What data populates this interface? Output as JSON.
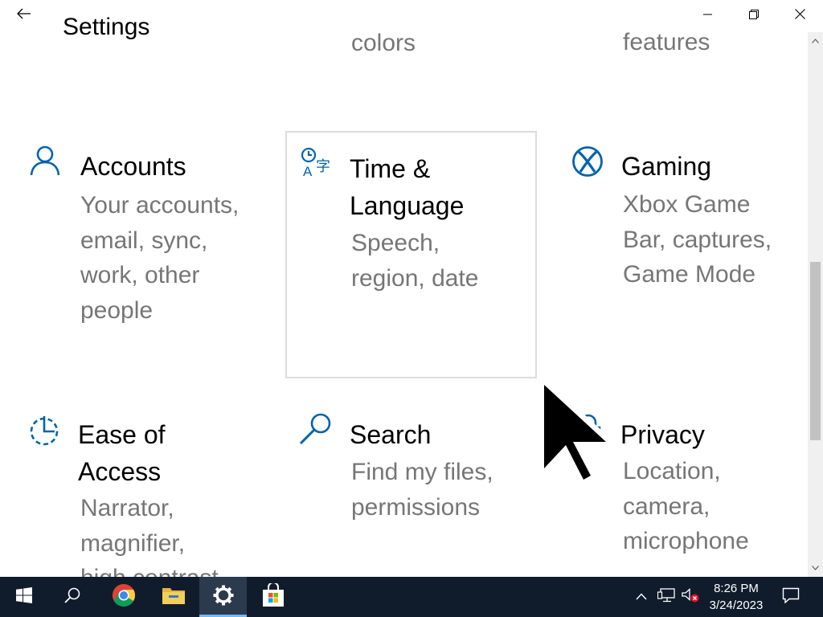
{
  "window": {
    "title": "Settings"
  },
  "partial_tiles": {
    "col2_desc_tail": "colors",
    "col3_desc_tail": "features"
  },
  "tiles": [
    {
      "icon": "person-icon",
      "title": "Accounts",
      "desc": "Your accounts,\nemail, sync,\nwork, other\npeople"
    },
    {
      "icon": "time-language-icon",
      "title": "Time &\nLanguage",
      "desc": "Speech,\nregion, date"
    },
    {
      "icon": "xbox-icon",
      "title": "Gaming",
      "desc": "Xbox Game\nBar, captures,\nGame Mode"
    },
    {
      "icon": "ease-of-access-icon",
      "title": "Ease of\nAccess",
      "desc": "Narrator,\nmagnifier,\nhigh contrast"
    },
    {
      "icon": "search-icon",
      "title": "Search",
      "desc": "Find my files,\npermissions"
    },
    {
      "icon": "lock-icon",
      "title": "Privacy",
      "desc": "Location,\ncamera,\nmicrophone"
    }
  ],
  "taskbar": {
    "apps": [
      "start",
      "search",
      "chrome",
      "file-explorer",
      "settings",
      "microsoft-store"
    ],
    "active_app": "settings",
    "accent": "#76b9ed"
  },
  "clock": {
    "time": "8:26 PM",
    "date": "3/24/2023"
  },
  "colors": {
    "accent_blue": "#0063b1",
    "description_gray": "#767676",
    "taskbar": "#101c2c"
  }
}
